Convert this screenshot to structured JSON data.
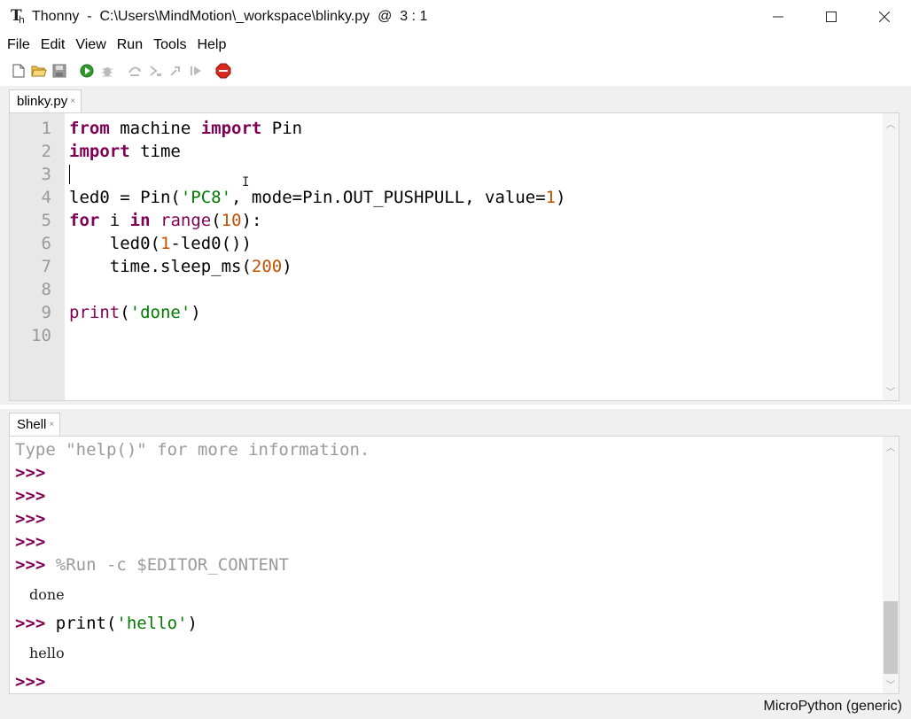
{
  "window": {
    "app_name": "Thonny",
    "title": "Thonny  -  C:\\Users\\MindMotion\\_workspace\\blinky.py  @  3 : 1"
  },
  "menu": [
    "File",
    "Edit",
    "View",
    "Run",
    "Tools",
    "Help"
  ],
  "toolbar": {
    "icons": [
      "new-file-icon",
      "open-folder-icon",
      "save-icon",
      "run-icon",
      "debug-icon",
      "step-over-icon",
      "step-into-icon",
      "step-out-icon",
      "resume-icon",
      "stop-icon"
    ]
  },
  "editor": {
    "tab_label": "blinky.py",
    "line_numbers": [
      "1",
      "2",
      "3",
      "4",
      "5",
      "6",
      "7",
      "8",
      "9",
      "10"
    ]
  },
  "shell": {
    "tab_label": "Shell",
    "help_line": "Type \"help()\" for more information.",
    "prompt": ">>>",
    "run_command": "%Run -c $EDITOR_CONTENT",
    "output_done": "done",
    "print_cmd_prefix": "print(",
    "print_cmd_arg": "'hello'",
    "print_cmd_suffix": ")",
    "output_hello": "hello"
  },
  "status": {
    "interpreter": "MicroPython (generic)"
  },
  "colors": {
    "keyword": "#7f0055",
    "string": "#007a00",
    "number": "#c25100",
    "gutter": "#e8e8e8"
  }
}
